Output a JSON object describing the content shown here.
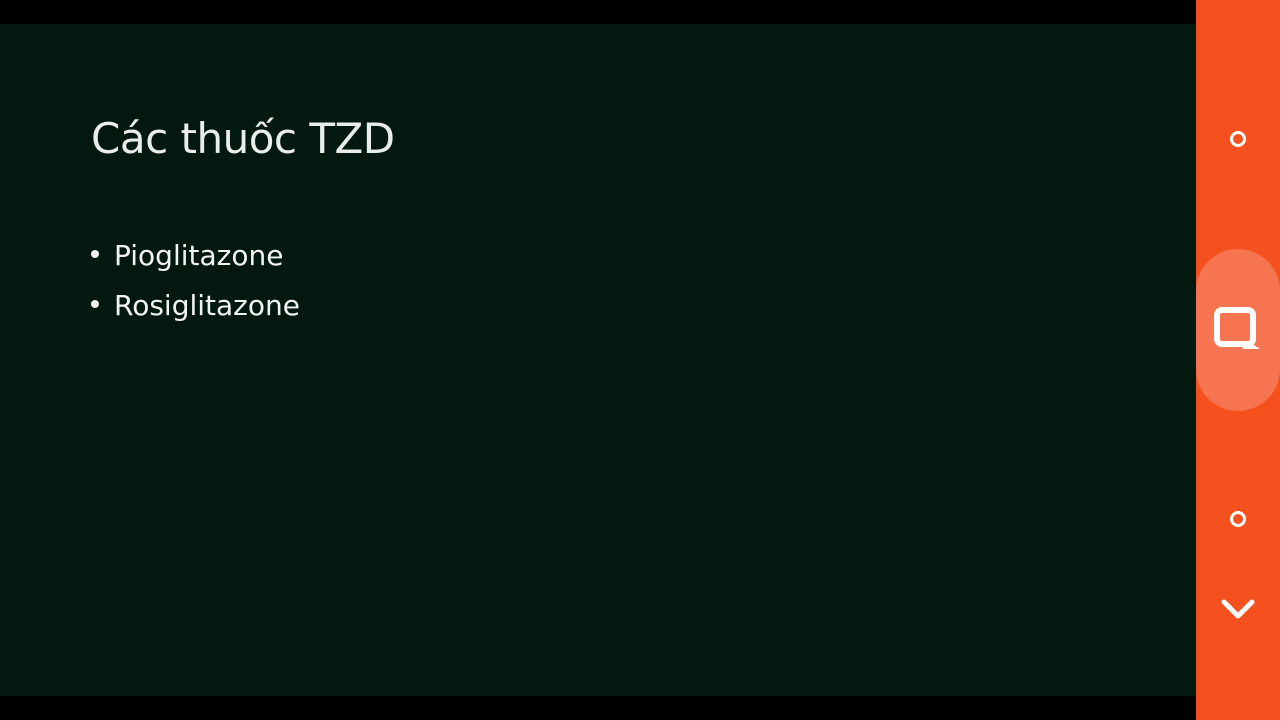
{
  "slide": {
    "title": "Các thuốc TZD",
    "bullets": [
      "Pioglitazone",
      "Rosiglitazone"
    ]
  },
  "side_panel": {
    "icons": [
      "small-circle-icon",
      "note-icon",
      "small-circle-icon",
      "chevron-down-icon"
    ]
  },
  "colors": {
    "slide_background": "#03180e",
    "panel_accent": "#f4511e",
    "pill_highlight": "#f67450",
    "text": "#f1f4f2"
  }
}
